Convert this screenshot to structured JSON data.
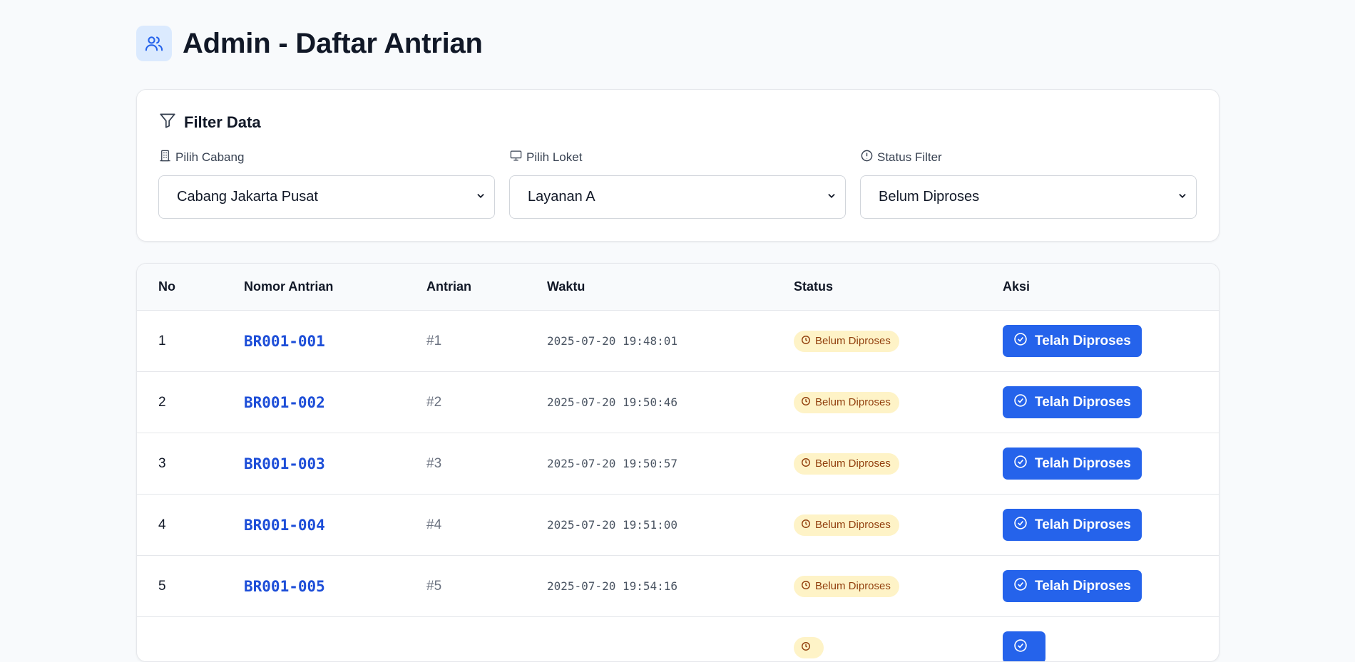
{
  "header": {
    "title": "Admin - Daftar Antrian",
    "icon": "users-icon"
  },
  "filter": {
    "title": "Filter Data",
    "fields": [
      {
        "label": "Pilih Cabang",
        "icon": "building-icon",
        "value": "Cabang Jakarta Pusat"
      },
      {
        "label": "Pilih Loket",
        "icon": "monitor-icon",
        "value": "Layanan A"
      },
      {
        "label": "Status Filter",
        "icon": "alert-circle-icon",
        "value": "Belum Diproses"
      }
    ]
  },
  "table": {
    "headers": [
      "No",
      "Nomor Antrian",
      "Antrian",
      "Waktu",
      "Status",
      "Aksi"
    ],
    "rows": [
      {
        "no": "1",
        "nomor": "BR001-001",
        "antrian": "#1",
        "waktu": "2025-07-20 19:48:01",
        "status": "Belum Diproses",
        "aksi": "Telah Diproses"
      },
      {
        "no": "2",
        "nomor": "BR001-002",
        "antrian": "#2",
        "waktu": "2025-07-20 19:50:46",
        "status": "Belum Diproses",
        "aksi": "Telah Diproses"
      },
      {
        "no": "3",
        "nomor": "BR001-003",
        "antrian": "#3",
        "waktu": "2025-07-20 19:50:57",
        "status": "Belum Diproses",
        "aksi": "Telah Diproses"
      },
      {
        "no": "4",
        "nomor": "BR001-004",
        "antrian": "#4",
        "waktu": "2025-07-20 19:51:00",
        "status": "Belum Diproses",
        "aksi": "Telah Diproses"
      },
      {
        "no": "5",
        "nomor": "BR001-005",
        "antrian": "#5",
        "waktu": "2025-07-20 19:54:16",
        "status": "Belum Diproses",
        "aksi": "Telah Diproses"
      },
      {
        "no": "",
        "nomor": "",
        "antrian": "",
        "waktu": "",
        "status": "",
        "aksi": ""
      }
    ]
  },
  "colors": {
    "accent": "#2563eb",
    "link": "#1d4ed8",
    "badge_bg": "#fef3c7",
    "badge_text": "#92400e"
  }
}
